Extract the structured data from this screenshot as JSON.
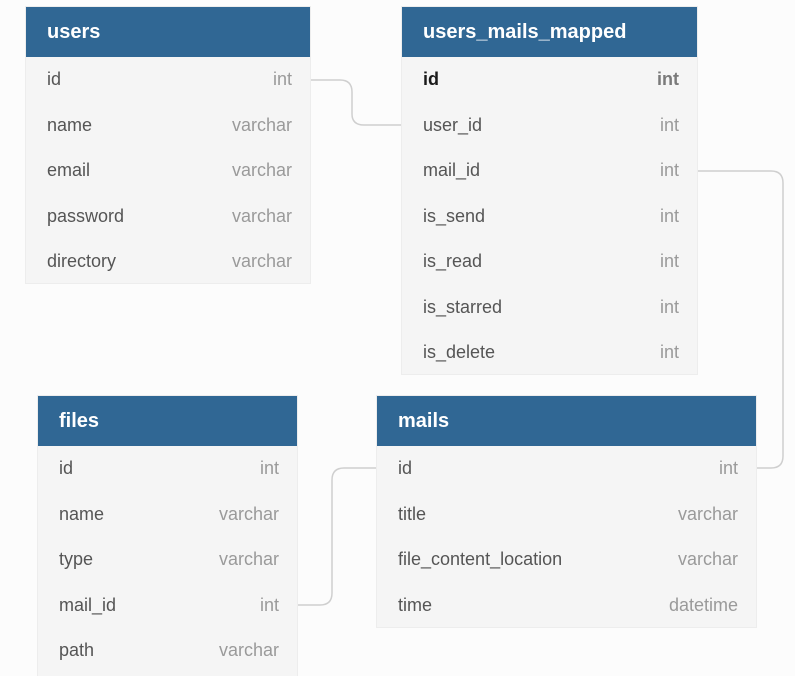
{
  "tables": [
    {
      "id": "users",
      "name": "users",
      "fields": [
        {
          "name": "id",
          "type": "int"
        },
        {
          "name": "name",
          "type": "varchar"
        },
        {
          "name": "email",
          "type": "varchar"
        },
        {
          "name": "password",
          "type": "varchar"
        },
        {
          "name": "directory",
          "type": "varchar"
        }
      ]
    },
    {
      "id": "ump",
      "name": "users_mails_mapped",
      "fields": [
        {
          "name": "id",
          "type": "int",
          "pk": true
        },
        {
          "name": "user_id",
          "type": "int"
        },
        {
          "name": "mail_id",
          "type": "int"
        },
        {
          "name": "is_send",
          "type": "int"
        },
        {
          "name": "is_read",
          "type": "int"
        },
        {
          "name": "is_starred",
          "type": "int"
        },
        {
          "name": "is_delete",
          "type": "int"
        }
      ]
    },
    {
      "id": "files",
      "name": "files",
      "fields": [
        {
          "name": "id",
          "type": "int"
        },
        {
          "name": "name",
          "type": "varchar"
        },
        {
          "name": "type",
          "type": "varchar"
        },
        {
          "name": "mail_id",
          "type": "int"
        },
        {
          "name": "path",
          "type": "varchar"
        }
      ]
    },
    {
      "id": "mails",
      "name": "mails",
      "fields": [
        {
          "name": "id",
          "type": "int"
        },
        {
          "name": "title",
          "type": "varchar"
        },
        {
          "name": "file_content_location",
          "type": "varchar"
        },
        {
          "name": "time",
          "type": "datetime"
        }
      ]
    }
  ],
  "relationships": [
    {
      "from": "users.id",
      "to": "users_mails_mapped.user_id"
    },
    {
      "from": "users_mails_mapped.mail_id",
      "to": "mails.id"
    },
    {
      "from": "mails.id",
      "to": "files.mail_id"
    }
  ],
  "colors": {
    "header": "#306794",
    "table_bg": "#f5f5f5",
    "connector": "#cfcfcf"
  }
}
